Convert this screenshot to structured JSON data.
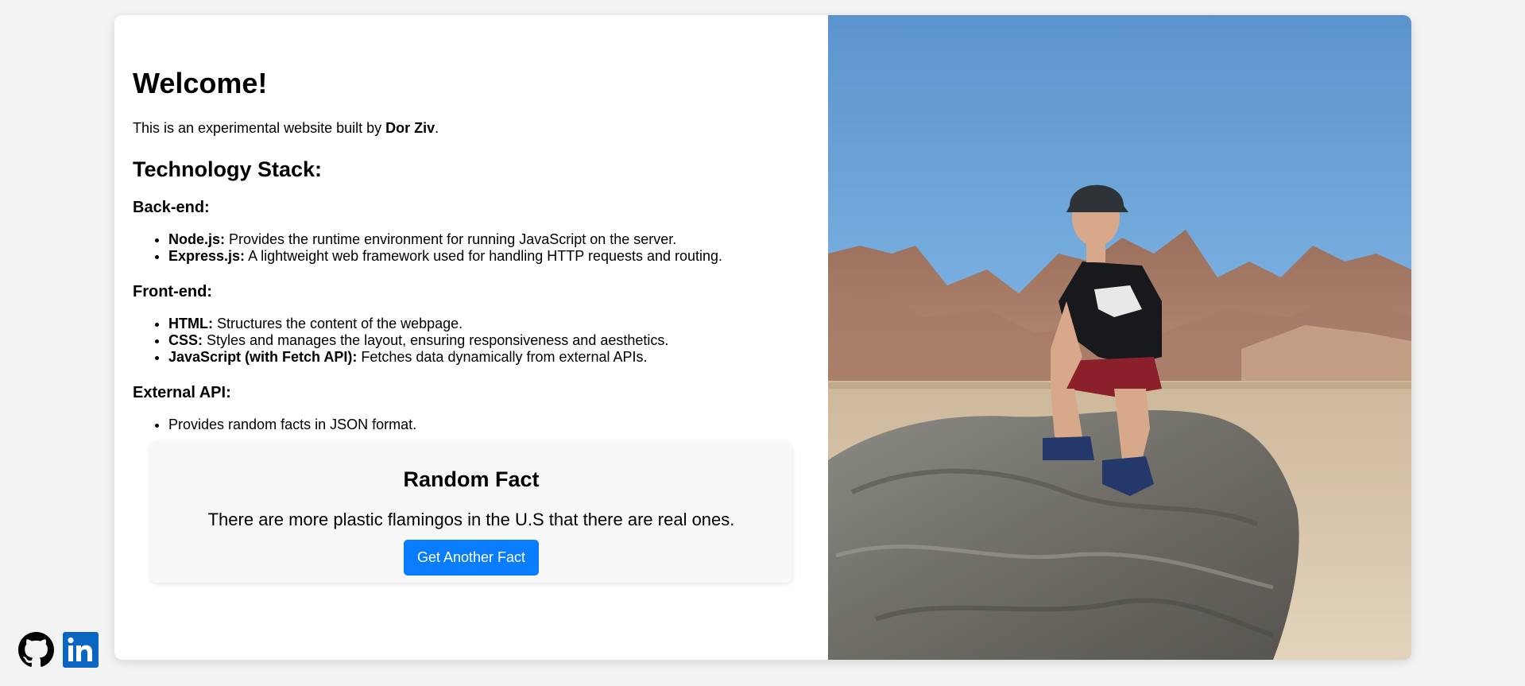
{
  "welcome": {
    "title": "Welcome!",
    "intro_prefix": "This is an experimental website built by ",
    "author": "Dor Ziv",
    "intro_suffix": "."
  },
  "stack": {
    "title": "Technology Stack:",
    "sections": [
      {
        "heading": "Back-end:",
        "items": [
          {
            "term": "Node.js:",
            "desc": " Provides the runtime environment for running JavaScript on the server."
          },
          {
            "term": "Express.js:",
            "desc": " A lightweight web framework used for handling HTTP requests and routing."
          }
        ]
      },
      {
        "heading": "Front-end:",
        "items": [
          {
            "term": "HTML:",
            "desc": " Structures the content of the webpage."
          },
          {
            "term": "CSS:",
            "desc": " Styles and manages the layout, ensuring responsiveness and aesthetics."
          },
          {
            "term": "JavaScript (with Fetch API):",
            "desc": " Fetches data dynamically from external APIs."
          }
        ]
      },
      {
        "heading": "External API:",
        "items": [
          {
            "term": "",
            "desc": "Provides random facts in JSON format."
          }
        ]
      }
    ]
  },
  "fact": {
    "title": "Random Fact",
    "text": "There are more plastic flamingos in the U.S that there are real ones.",
    "button_label": "Get Another Fact"
  },
  "photo": {
    "icon": "portrait-photo"
  },
  "socials": [
    {
      "name": "github-icon"
    },
    {
      "name": "linkedin-icon"
    }
  ],
  "colors": {
    "accent": "#0a7cff",
    "page_bg": "#f3f3f3",
    "linkedin": "#0a66c2"
  }
}
